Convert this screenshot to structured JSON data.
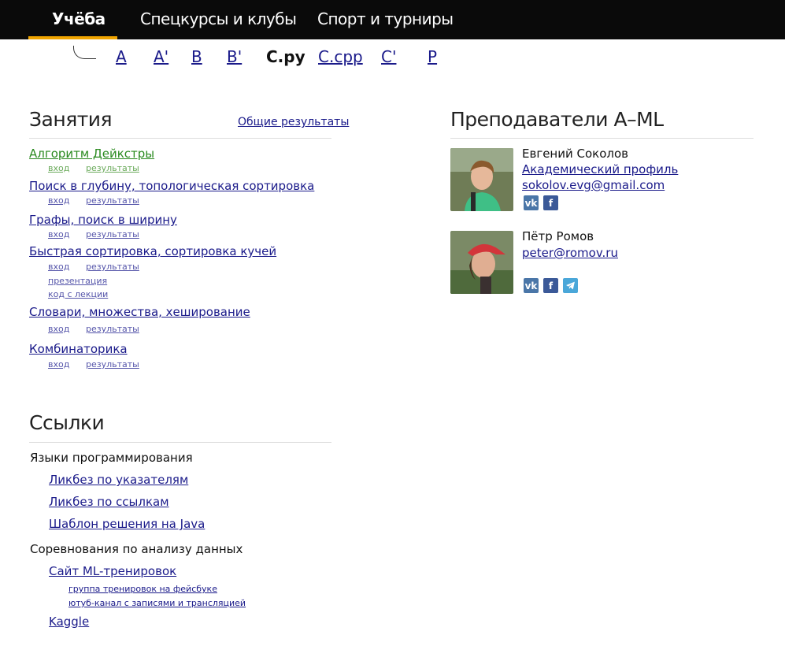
{
  "nav": {
    "tabs": [
      "Учёба",
      "Спецкурсы и клубы",
      "Спорт и турниры"
    ]
  },
  "subnav": {
    "items": [
      "A",
      "A'",
      "B",
      "B'",
      "C.py",
      "C.cpp",
      "C'",
      "P"
    ]
  },
  "lessons": {
    "title": "Занятия",
    "all_results": "Общие результаты",
    "items": [
      {
        "title": "Алгоритм Дейкстры",
        "in": "вход",
        "results": "результаты"
      },
      {
        "title": "Поиск в глубину, топологическая сортировка",
        "in": "вход",
        "results": "результаты"
      },
      {
        "title": "Графы, поиск в ширину",
        "in": "вход",
        "results": "результаты"
      },
      {
        "title": "Быстрая сортировка, сортировка кучей",
        "in": "вход",
        "results": "результаты",
        "extra1": "презентация",
        "extra2": "код с лекции"
      },
      {
        "title": "Словари, множества, хеширование",
        "in": "вход",
        "results": "результаты"
      },
      {
        "title": "Комбинаторика",
        "in": "вход",
        "results": "результаты"
      }
    ]
  },
  "teachers": {
    "title": "Преподаватели A–ML",
    "list": [
      {
        "name": "Евгений Соколов",
        "profile": "Академический профиль",
        "email": "sokolov.evg@gmail.com"
      },
      {
        "name": "Пётр Ромов",
        "email": "peter@romov.ru"
      }
    ],
    "social": {
      "vk": "vk",
      "fb": "f"
    },
    "colors": {
      "vk": "#4a76a8",
      "fb": "#3b5998",
      "tg": "#4aa7d9"
    }
  },
  "links": {
    "title": "Ссылки",
    "groups": [
      {
        "head": "Языки программирования",
        "items": [
          "Ликбез по указателям",
          "Ликбез по ссылкам",
          "Шаблон решения на Java"
        ]
      },
      {
        "head": "Соревнования по анализу данных",
        "items": [
          "Сайт ML-тренировок",
          "Kaggle"
        ],
        "sub": [
          "группа тренировок на фейсбуке",
          "ютуб-канал с записями и трансляцией"
        ]
      }
    ]
  },
  "colors": {
    "accent": "#f0a400",
    "link": "#1a1a8a",
    "done": "#2a8a1f"
  }
}
